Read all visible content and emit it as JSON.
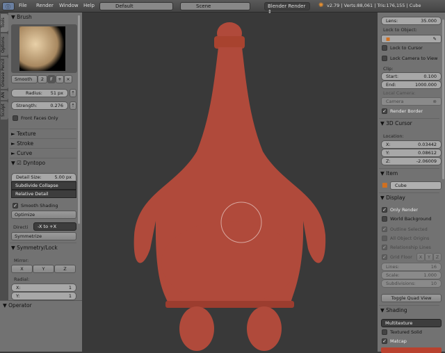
{
  "topbar": {
    "menus": [
      "File",
      "Render",
      "Window",
      "Help"
    ],
    "layout": "Default",
    "scene": "Scene",
    "engine": "Blender Render",
    "stats": "v2.79 | Verts:88,061 | Tris:176,155 | Cube"
  },
  "tabs": [
    "Tools",
    "Options",
    "Grease Pencil",
    "AN",
    "Sculpt"
  ],
  "left": {
    "brush_header": "Brush",
    "brush_name": "Smooth",
    "brush_users": "2",
    "brush_fake": "F",
    "radius_label": "Radius:",
    "radius_value": "51 px",
    "strength_label": "Strength:",
    "strength_value": "0.276",
    "front_faces": "Front Faces Only",
    "texture": "Texture",
    "stroke": "Stroke",
    "curve": "Curve",
    "dyntopo": "Dyntopo",
    "detail_label": "Detail Size:",
    "detail_value": "5.00 px",
    "subdivide": "Subdivide Collapse",
    "relative": "Relative Detail",
    "smooth_shading": "Smooth Shading",
    "optimize": "Optimize",
    "direction_label": "Directi",
    "direction_value": "-X to +X",
    "symmetrize": "Symmetrize",
    "symmetry": "Symmetry/Lock",
    "mirror": "Mirror:",
    "x": "X",
    "y": "Y",
    "z": "Z",
    "radial": "Radial:",
    "rx_label": "X:",
    "rx": "1",
    "ry_label": "Y:",
    "ry": "1",
    "operator": "Operator"
  },
  "right": {
    "lens_label": "Lens:",
    "lens": "35.000",
    "lock_object": "Lock to Object:",
    "lock_cursor": "Lock to Cursor",
    "lock_camera": "Lock Camera to View",
    "clip": "Clip:",
    "start_label": "Start:",
    "start": "0.100",
    "end_label": "End:",
    "end": "1000.000",
    "local_camera": "Local Camera:",
    "camera": "Camera",
    "render_border": "Render Border",
    "cursor": "3D Cursor",
    "location": "Location:",
    "cx_label": "X:",
    "cx": "0.03442",
    "cy_label": "Y:",
    "cy": "0.08612",
    "cz_label": "Z:",
    "cz": "-2.06009",
    "item": "Item",
    "item_name": "Cube",
    "display": "Display",
    "only_render": "Only Render",
    "world_bg": "World Background",
    "outline": "Outline Selected",
    "origins": "All Object Origins",
    "relationship": "Relationship Lines",
    "grid_floor": "Grid Floor",
    "gx": "X",
    "gy": "Y",
    "gz": "Z",
    "lines_label": "Lines:",
    "lines": "16",
    "scale_label": "Scale:",
    "scale": "1.000",
    "subdiv_label": "Subdivisions:",
    "subdiv": "10",
    "toggle_quad": "Toggle Quad View",
    "shading": "Shading",
    "shading_mode": "Multitexture",
    "textured_solid": "Textured Solid",
    "matcap": "Matcap"
  },
  "colors": {
    "model": "#b04a3b",
    "matcap": "#b8412e"
  }
}
